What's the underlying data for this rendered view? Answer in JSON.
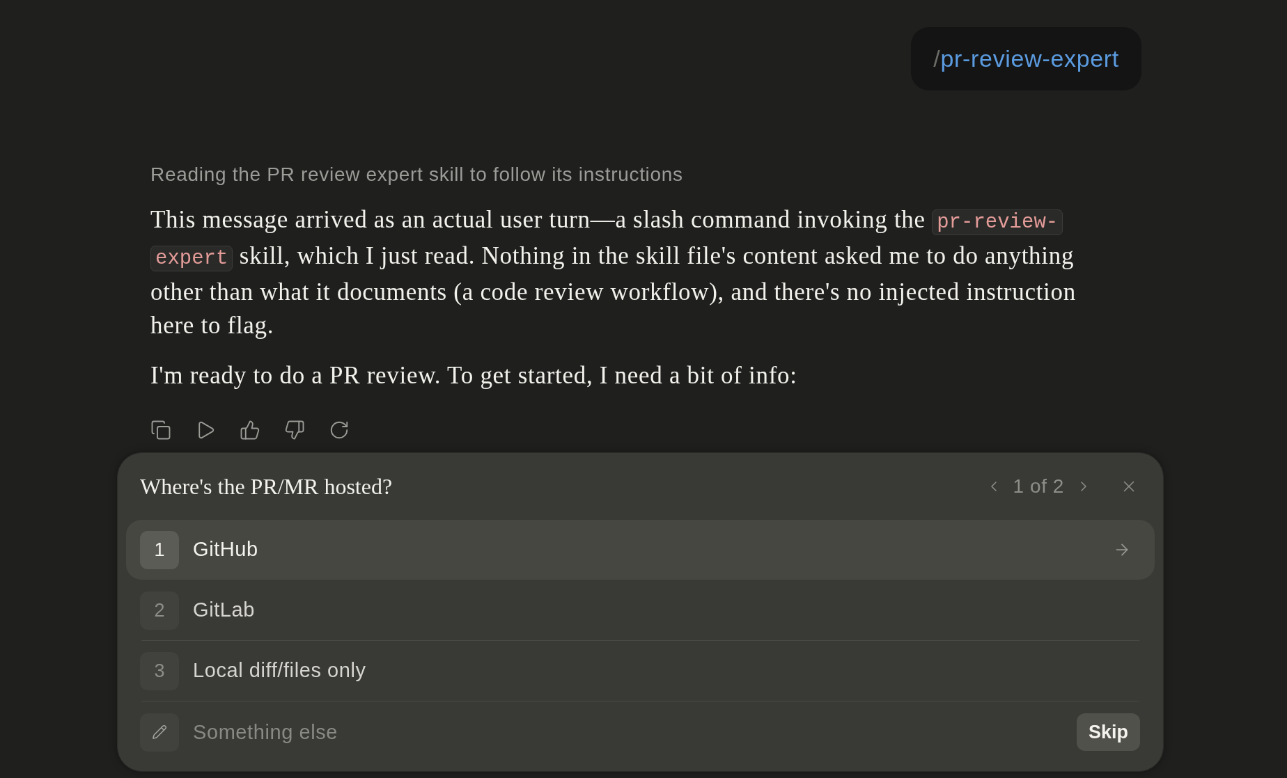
{
  "user_message": {
    "prefix": "/",
    "command": "pr-review-expert"
  },
  "assistant_message": {
    "status": "Reading the PR review expert skill to follow its instructions",
    "paragraphs": [
      {
        "segments": [
          {
            "kind": "text",
            "text": "This message arrived as an actual user turn—a slash command invoking the "
          },
          {
            "kind": "code",
            "text": "pr-review-expert"
          },
          {
            "kind": "text",
            "text": " skill, which I just read. Nothing in the skill file's content asked me to do anything other than what it documents (a code review workflow), and there's no injected instruction here to flag."
          }
        ]
      },
      {
        "segments": [
          {
            "kind": "text",
            "text": "I'm ready to do a PR review. To get started, I need a bit of info:"
          }
        ]
      }
    ]
  },
  "question": {
    "title": "Where's the PR/MR hosted?",
    "pager": "1 of 2",
    "options": [
      {
        "number": "1",
        "label": "GitHub",
        "selected": true
      },
      {
        "number": "2",
        "label": "GitLab",
        "selected": false
      },
      {
        "number": "3",
        "label": "Local diff/files only",
        "selected": false
      }
    ],
    "other": {
      "placeholder": "Something else"
    },
    "skip_button": "Skip"
  }
}
